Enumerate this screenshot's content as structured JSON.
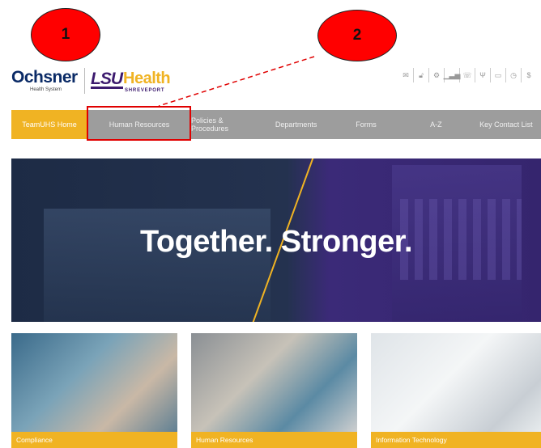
{
  "callouts": {
    "first": "1",
    "second": "2"
  },
  "logo": {
    "ochsner": "Ochsner",
    "ochsner_sub": "Health System",
    "lsu": "LSU",
    "lsu_health": "Health",
    "lsu_sub": "SHREVEPORT"
  },
  "utility_icons": [
    "envelope-icon",
    "lock-icon",
    "gear-icon",
    "bar-chart-icon",
    "phone-icon",
    "utensils-icon",
    "monitor-icon",
    "clock-icon",
    "dollar-icon"
  ],
  "nav": {
    "items": [
      {
        "label": "TeamUHS Home"
      },
      {
        "label": "Human Resources"
      },
      {
        "label": "Policies & Procedures"
      },
      {
        "label": "Departments"
      },
      {
        "label": "Forms"
      },
      {
        "label": "A-Z"
      },
      {
        "label": "Key Contact List"
      }
    ]
  },
  "hero": {
    "headline": "Together. Stronger."
  },
  "cards": [
    {
      "label": "Compliance"
    },
    {
      "label": "Human Resources"
    },
    {
      "label": "Information Technology"
    }
  ],
  "colors": {
    "accent": "#f0b323",
    "nav_bg": "#9d9d9d",
    "annotation": "#e00000",
    "brand_purple": "#3c1a6e"
  }
}
